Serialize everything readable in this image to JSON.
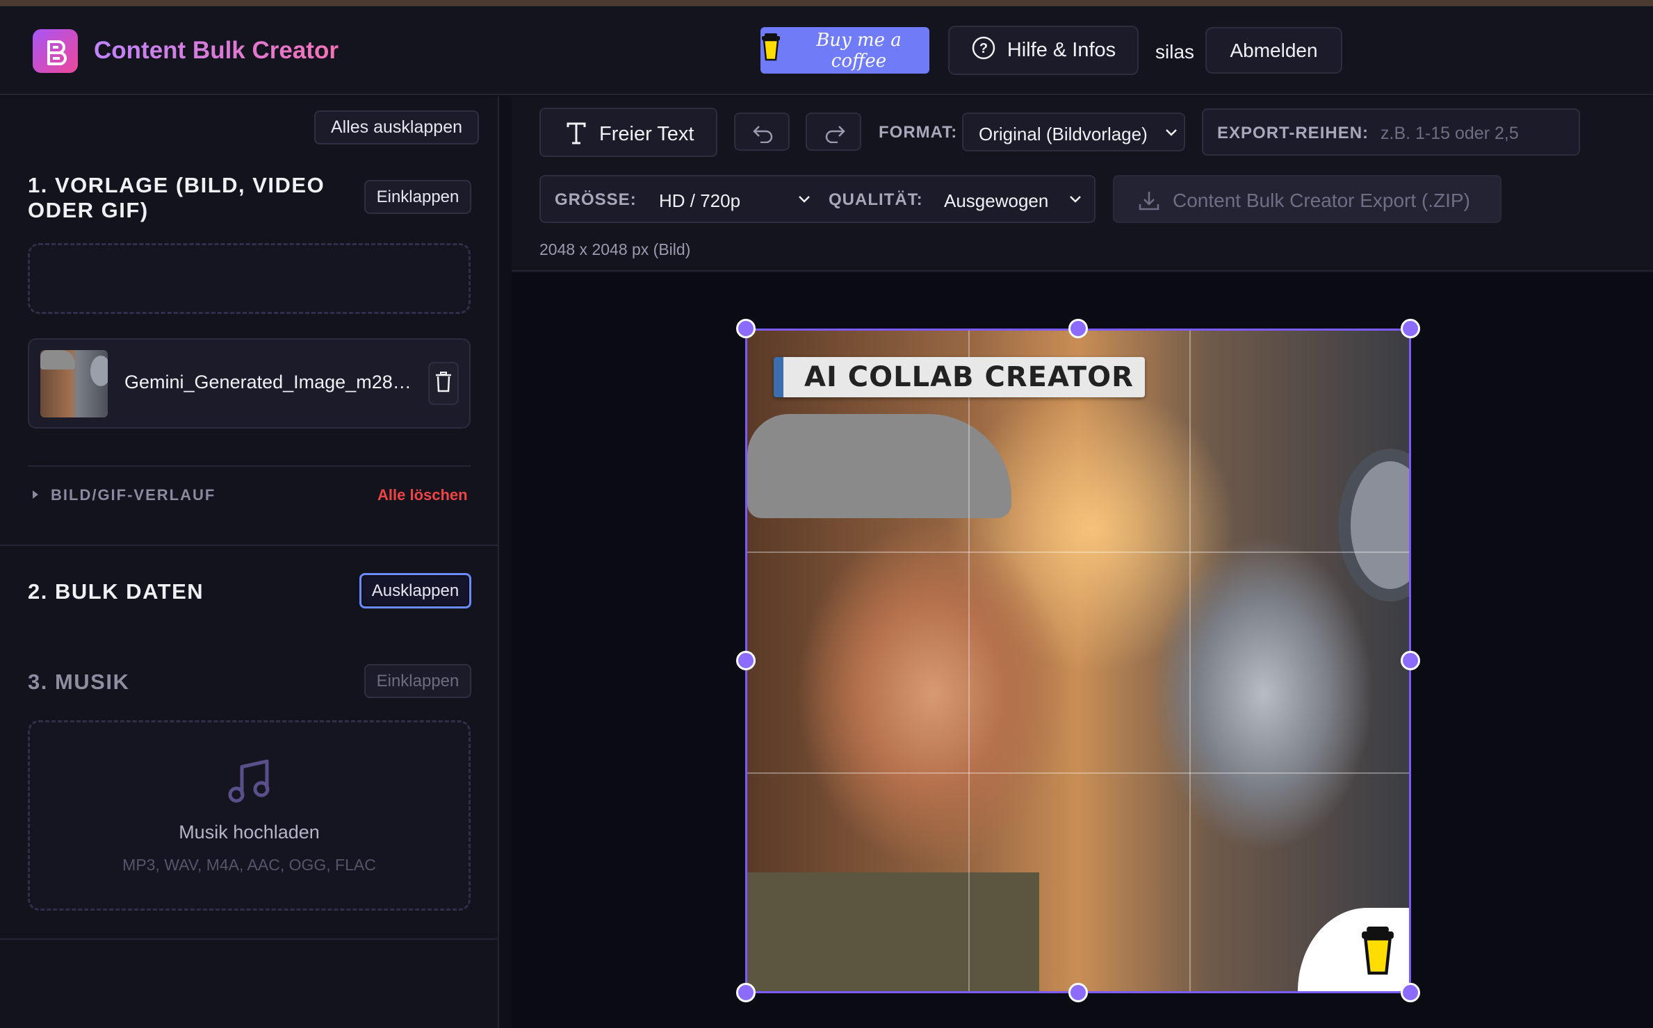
{
  "app": {
    "title": "Content Bulk Creator",
    "accent": "#8b6cff",
    "danger": "#ef4444"
  },
  "header": {
    "coffee_label": "Buy me a coffee",
    "help_label": "Hilfe & Infos",
    "username": "silas",
    "logout_label": "Abmelden"
  },
  "sidebar": {
    "expand_all_label": "Alles ausklappen",
    "section1": {
      "title_line1": "1. VORLAGE (BILD, VIDEO",
      "title_line2": "ODER GIF)",
      "toggle_label": "Einklappen",
      "file_name": "Gemini_Generated_Image_m28m…",
      "history_label": "BILD/GIF-VERLAUF",
      "delete_all_label": "Alle löschen"
    },
    "section2": {
      "title": "2. BULK DATEN",
      "toggle_label": "Ausklappen"
    },
    "section3": {
      "title": "3. MUSIK",
      "toggle_label": "Einklappen",
      "upload_label": "Musik hochladen",
      "formats": "MP3, WAV, M4A, AAC, OGG, FLAC"
    }
  },
  "toolbar": {
    "free_text_label": "Freier Text",
    "format_label": "FORMAT:",
    "format_value": "Original (Bildvorlage)",
    "export_rows_label": "EXPORT-REIHEN:",
    "export_rows_placeholder": "z.B. 1-15 oder 2,5",
    "size_label": "GRÖSSE:",
    "size_value": "HD / 720p",
    "quality_label": "QUALITÄT:",
    "quality_value": "Ausgewogen",
    "export_button_label": "Content Bulk Creator Export (.ZIP)",
    "info": "2048 x 2048 px (Bild)"
  },
  "canvas": {
    "overlay_text": "AI COLLAB CREATOR"
  },
  "icons": {
    "logo": "logo-b-icon",
    "coffee": "coffee-cup-icon",
    "help": "question-circle-icon",
    "text_tool": "text-t-icon",
    "undo": "undo-icon",
    "redo": "redo-icon",
    "download": "download-icon",
    "trash": "trash-icon",
    "music": "music-note-icon",
    "chevron": "chevron-down-icon",
    "caret": "caret-right-icon"
  }
}
